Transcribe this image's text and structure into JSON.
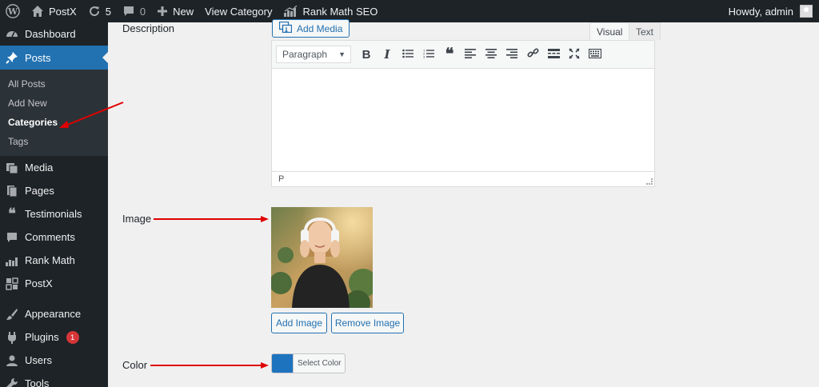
{
  "admin_bar": {
    "site_name": "PostX",
    "updates_count": "5",
    "comments_count": "0",
    "new_label": "New",
    "view_category": "View Category",
    "rank_math": "Rank Math SEO",
    "greeting": "Howdy, admin"
  },
  "sidebar": {
    "items_top": [
      {
        "label": "Dashboard",
        "icon": "dashboard-icon"
      },
      {
        "label": "Posts",
        "icon": "pin-icon"
      }
    ],
    "submenu": [
      "All Posts",
      "Add New",
      "Categories",
      "Tags"
    ],
    "submenu_active": "Categories",
    "items_bottom": [
      {
        "label": "Media",
        "icon": "media-icon"
      },
      {
        "label": "Pages",
        "icon": "pages-icon"
      },
      {
        "label": "Testimonials",
        "icon": "quote-icon"
      },
      {
        "label": "Comments",
        "icon": "comment-icon"
      },
      {
        "label": "Rank Math",
        "icon": "chart-icon"
      },
      {
        "label": "PostX",
        "icon": "postx-icon"
      },
      {
        "label": "Appearance",
        "icon": "brush-icon"
      },
      {
        "label": "Plugins",
        "icon": "plugin-icon",
        "badge": "1"
      },
      {
        "label": "Users",
        "icon": "user-icon"
      },
      {
        "label": "Tools",
        "icon": "wrench-icon"
      }
    ]
  },
  "form": {
    "description_label": "Description",
    "image_label": "Image",
    "color_label": "Color"
  },
  "editor": {
    "add_media": "Add Media",
    "tab_visual": "Visual",
    "tab_text": "Text",
    "format_select": "Paragraph",
    "path": "P"
  },
  "image_section": {
    "add_image": "Add Image",
    "remove_image": "Remove Image"
  },
  "color_section": {
    "select_color": "Select Color",
    "swatch_color": "#1e73be"
  },
  "colors": {
    "accent": "#2271b1",
    "annotation": "#e00000"
  }
}
